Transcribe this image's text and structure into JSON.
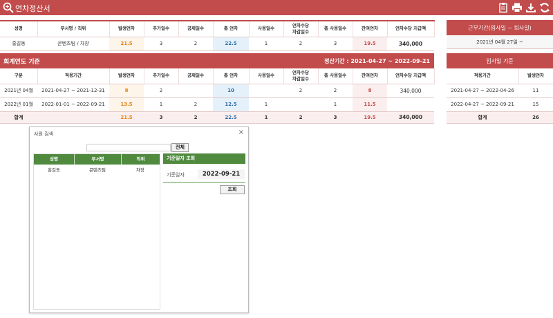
{
  "app": {
    "title": "연차정산서"
  },
  "toolbar": {
    "icons": [
      "clipboard-icon",
      "print-icon",
      "download-icon",
      "refresh-icon"
    ]
  },
  "employee_table": {
    "headers": [
      "성명",
      "부서명 / 직위",
      "발생연차",
      "추가일수",
      "공제일수",
      "총 연차",
      "사용일수",
      "연차수당\n차감일수",
      "총 사용일수",
      "잔여연차",
      "연차수당 지급액"
    ],
    "row": [
      "홍길동",
      "콘텐츠팀 / 차장",
      "21.5",
      "3",
      "2",
      "22.5",
      "1",
      "2",
      "3",
      "19.5",
      "340,000"
    ]
  },
  "work_period": {
    "header": "근무기간(입사일 ~ 퇴사일)",
    "value": "2021년 04월 27일 ~"
  },
  "fiscal": {
    "title": "회계연도 기준",
    "period_label": "정산기간 : 2021-04-27 ~ 2022-09-21",
    "headers": [
      "구분",
      "적용기간",
      "발생연차",
      "추가일수",
      "공제일수",
      "총 연차",
      "사용일수",
      "연차수당\n차감일수",
      "총 사용일수",
      "잔여연차",
      "연차수당 지급액"
    ],
    "rows": [
      [
        "2021년 04월",
        "2021-04-27 ~ 2021-12-31",
        "8",
        "2",
        "",
        "10",
        "",
        "2",
        "2",
        "8",
        "340,000"
      ],
      [
        "2022년 01월",
        "2022-01-01 ~ 2022-09-21",
        "13.5",
        "1",
        "2",
        "12.5",
        "1",
        "",
        "1",
        "11.5",
        ""
      ]
    ],
    "total": [
      "합계",
      "",
      "21.5",
      "3",
      "2",
      "22.5",
      "1",
      "2",
      "3",
      "19.5",
      "340,000"
    ]
  },
  "hire_based": {
    "title": "입사일 기준",
    "headers": [
      "적용기간",
      "발생연차"
    ],
    "rows": [
      [
        "2021-04-27 ~ 2022-04-26",
        "11"
      ],
      [
        "2022-04-27 ~ 2022-09-21",
        "15"
      ]
    ],
    "total": [
      "합계",
      "26"
    ]
  },
  "dialog": {
    "title": "사원 검색",
    "close": "×",
    "search_value": "",
    "all_button": "전체",
    "grid_headers": [
      "성명",
      "부서명",
      "직위"
    ],
    "grid_rows": [
      [
        "홍길동",
        "콘텐츠팀",
        "차장"
      ]
    ],
    "date_panel_title": "기준일자 조회",
    "date_label": "기준일자",
    "date_value": "2022-09-21",
    "lookup_button": "조회"
  }
}
